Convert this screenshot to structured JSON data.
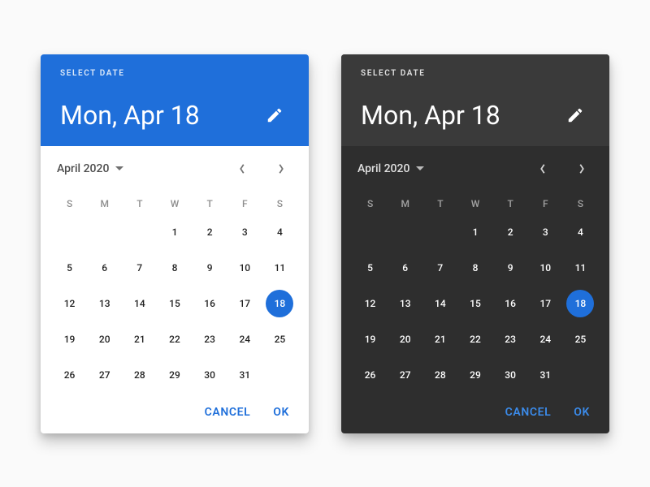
{
  "colors": {
    "primary": "#1f6fda"
  },
  "overline": "SELECT DATE",
  "headline": "Mon, Apr 18",
  "month_label": "April 2020",
  "dow": [
    "S",
    "M",
    "T",
    "W",
    "T",
    "F",
    "S"
  ],
  "leading_blanks": 3,
  "days_in_month": 31,
  "selected_day": 18,
  "actions": {
    "cancel": "CANCEL",
    "ok": "OK"
  }
}
